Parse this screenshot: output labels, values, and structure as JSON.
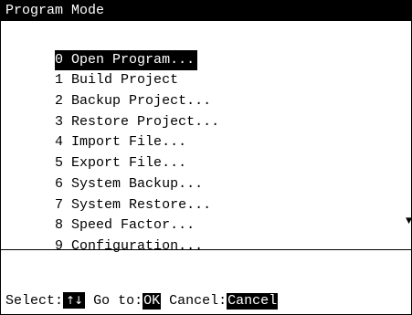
{
  "title": "Program Mode",
  "menu_items": [
    {
      "key": "0",
      "label": "Open Program..."
    },
    {
      "key": "1",
      "label": "Build Project"
    },
    {
      "key": "2",
      "label": "Backup Project..."
    },
    {
      "key": "3",
      "label": "Restore Project..."
    },
    {
      "key": "4",
      "label": "Import File..."
    },
    {
      "key": "5",
      "label": "Export File..."
    },
    {
      "key": "6",
      "label": "System Backup..."
    },
    {
      "key": "7",
      "label": "System Restore..."
    },
    {
      "key": "8",
      "label": "Speed Factor..."
    },
    {
      "key": "9",
      "label": "Configuration..."
    }
  ],
  "selected_index": 0,
  "scroll_indicator": "▼",
  "status": {
    "select_label": "Select:",
    "select_key": "↑↓",
    "goto_label": " Go to:",
    "goto_key": "OK",
    "cancel_label": " Cancel:",
    "cancel_key": "Cancel"
  }
}
